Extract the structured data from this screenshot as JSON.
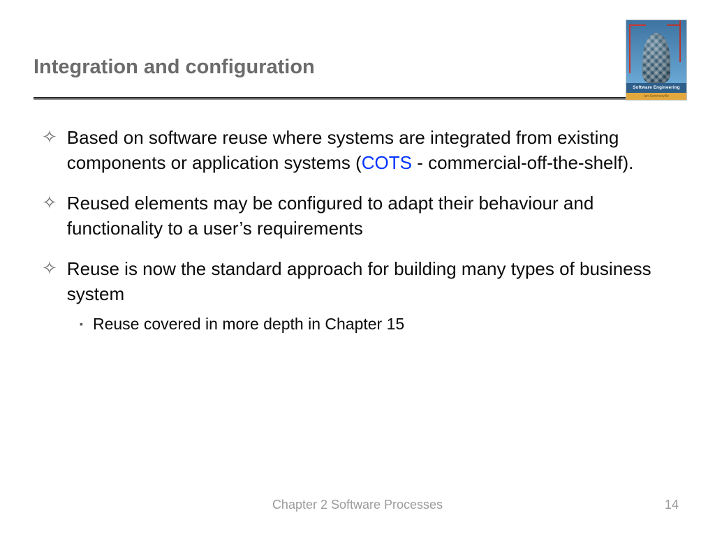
{
  "slide": {
    "title": "Integration and configuration",
    "cover": {
      "band": "Software Engineering",
      "author": "Ian Sommerville"
    },
    "bullets": [
      {
        "text_pre": "Based on software reuse where systems are integrated from existing components or application systems (",
        "hot": "COTS",
        "text_post": " - commercial-off-the-shelf).",
        "sub": []
      },
      {
        "text_pre": "Reused elements may be configured to adapt their behaviour and functionality to a user’s requirements",
        "hot": "",
        "text_post": "",
        "sub": []
      },
      {
        "text_pre": "Reuse is now the standard approach for building many types of business system",
        "hot": "",
        "text_post": "",
        "sub": [
          "Reuse covered in more depth in Chapter 15"
        ]
      }
    ],
    "footer": "Chapter 2 Software Processes",
    "page": "14"
  }
}
